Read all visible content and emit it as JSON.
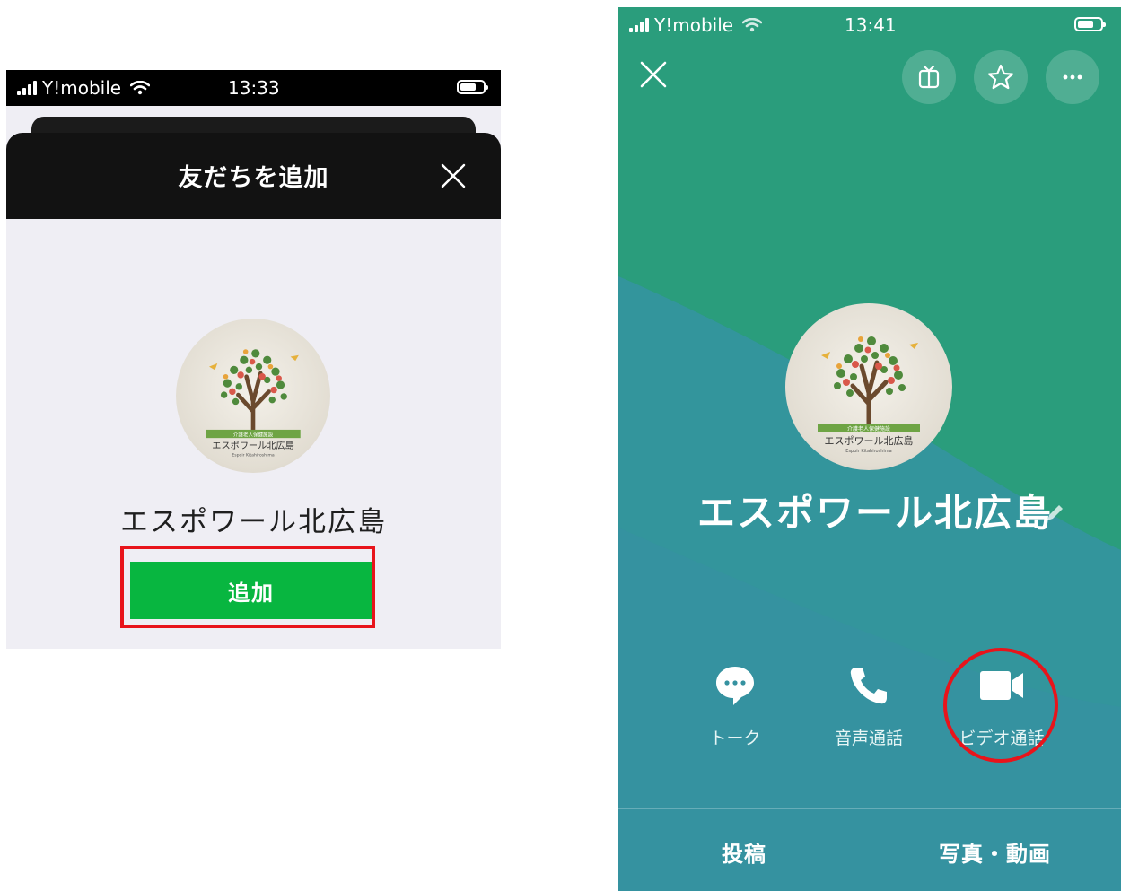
{
  "left_screen": {
    "status_bar": {
      "carrier": "Y!mobile",
      "time": "13:33",
      "wifi_icon": "wifi-icon",
      "battery_icon": "battery-icon"
    },
    "header": {
      "title": "友だちを追加",
      "close_icon": "close-icon"
    },
    "profile": {
      "name": "エスポワール北広島",
      "logo_caption_top": "介護老人保健施設",
      "logo_caption_main": "エスポワール北広島",
      "logo_caption_sub": "Espoir Kitahiroshima"
    },
    "add_button": {
      "label": "追加"
    },
    "highlight_color": "#e8141b"
  },
  "right_screen": {
    "status_bar": {
      "carrier": "Y!mobile",
      "time": "13:41"
    },
    "top_actions": [
      "close-icon",
      "keep-icon",
      "star-icon",
      "more-icon"
    ],
    "profile": {
      "name": "エスポワール北広島",
      "logo_caption_top": "介護老人保健施設",
      "logo_caption_main": "エスポワール北広島",
      "logo_caption_sub": "Espoir Kitahiroshima"
    },
    "actions": [
      {
        "label": "トーク",
        "icon": "chat-bubble-icon"
      },
      {
        "label": "音声通話",
        "icon": "phone-icon"
      },
      {
        "label": "ビデオ通話",
        "icon": "video-camera-icon"
      }
    ],
    "bottom_tabs": [
      {
        "label": "投稿"
      },
      {
        "label": "写真・動画"
      }
    ],
    "colors": {
      "bg_top": "#2a9d7c",
      "bg_bottom": "#3592a0",
      "highlight": "#e8141b"
    }
  }
}
